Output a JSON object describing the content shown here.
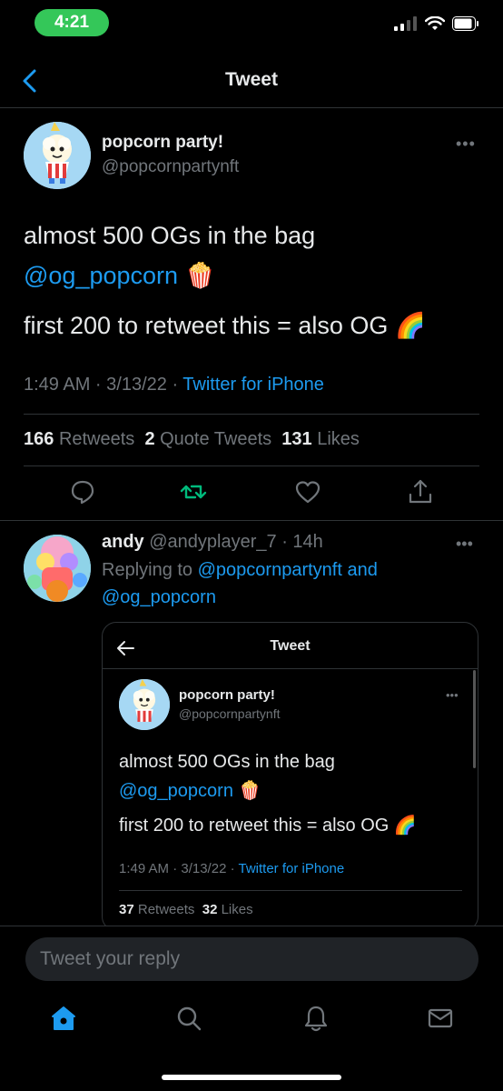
{
  "status_bar": {
    "time": "4:21"
  },
  "nav": {
    "title": "Tweet"
  },
  "tweet": {
    "author_name": "popcorn party!",
    "author_handle": "@popcornpartynft",
    "line1": "almost 500 OGs in the bag",
    "mention": "@og_popcorn",
    "popcorn_emoji": "🍿",
    "line3": "first 200 to retweet this = also OG",
    "rainbow_emoji": "🌈",
    "time": "1:49 AM · 3/13/22 · ",
    "source": "Twitter for iPhone",
    "retweets_count": "166",
    "retweets_label": "Retweets",
    "quotes_count": "2",
    "quotes_label": "Quote Tweets",
    "likes_count": "131",
    "likes_label": "Likes"
  },
  "reply": {
    "name": "andy",
    "handle_time": "@andyplayer_7 · 14h",
    "replying_prefix": "Replying to ",
    "replying_user1": "@popcornpartynft",
    "replying_and": " and",
    "replying_user2": "@og_popcorn",
    "embed": {
      "title": "Tweet",
      "author_name": "popcorn party!",
      "author_handle": "@popcornpartynft",
      "line1": "almost 500 OGs in the bag",
      "mention": "@og_popcorn",
      "popcorn_emoji": "🍿",
      "line3": "first 200 to retweet this = also OG",
      "rainbow_emoji": "🌈",
      "time": "1:49 AM · 3/13/22 · ",
      "source": "Twitter for iPhone",
      "retweets_count": "37",
      "retweets_label": "Retweets",
      "likes_count": "32",
      "likes_label": "Likes"
    }
  },
  "composer": {
    "placeholder": "Tweet your reply"
  },
  "icons": {
    "back": "chevron-left-icon",
    "more": "more-horizontal-icon",
    "reply": "comment-icon",
    "retweet": "retweet-icon",
    "like": "heart-icon",
    "share": "share-icon",
    "home": "home-icon",
    "search": "search-icon",
    "notifications": "bell-icon",
    "messages": "mail-icon"
  },
  "colors": {
    "accent": "#1d9bf0",
    "retweet": "#00ba7c",
    "status_pill": "#34c759"
  }
}
